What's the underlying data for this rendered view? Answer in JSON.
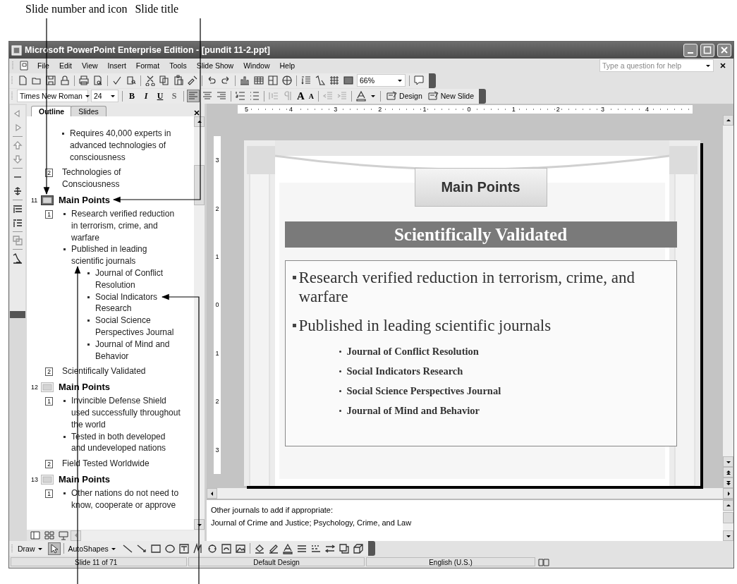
{
  "annotations": {
    "labels": [
      "Slide number and icon",
      "Slide title"
    ]
  },
  "window": {
    "title": "Microsoft PowerPoint Enterprise Edition - [pundit 11-2.ppt]"
  },
  "menu": [
    "File",
    "Edit",
    "View",
    "Insert",
    "Format",
    "Tools",
    "Slide Show",
    "Window",
    "Help"
  ],
  "help": {
    "placeholder": "Type a question for help"
  },
  "standard_toolbar": {
    "zoom": "66%"
  },
  "formatting_toolbar": {
    "font": "Times New Roman",
    "size": "24",
    "styles": [
      "B",
      "I",
      "U",
      "S"
    ],
    "font_size_buttons": [
      "A",
      "A"
    ],
    "buttons": [
      "Design",
      "New Slide"
    ]
  },
  "outline_pane": {
    "tabs": [
      {
        "label": "Outline",
        "selected": true
      },
      {
        "label": "Slides",
        "selected": false
      }
    ],
    "entries": [
      {
        "kind": "continuation",
        "placeholders": [
          {
            "bullets": [
              {
                "text": "Requires 40,000 experts in advanced technologies of consciousness"
              }
            ]
          },
          {
            "marker": "2",
            "text": "Technologies of Consciousness"
          }
        ]
      },
      {
        "kind": "slide",
        "number": "11",
        "title": "Main Points",
        "selected": true,
        "placeholders": [
          {
            "marker": "1",
            "bullets": [
              {
                "text": "Research verified reduction in terrorism, crime, and warfare"
              },
              {
                "text": "Published in leading scientific journals",
                "children": [
                  {
                    "text": "Journal of Conflict Resolution"
                  },
                  {
                    "text": "Social Indicators Research"
                  },
                  {
                    "text": "Social Science Perspectives Journal"
                  },
                  {
                    "text": "Journal of Mind and Behavior"
                  }
                ]
              }
            ]
          },
          {
            "marker": "2",
            "text": "Scientifically Validated"
          }
        ]
      },
      {
        "kind": "slide",
        "number": "12",
        "title": "Main Points",
        "selected": false,
        "placeholders": [
          {
            "marker": "1",
            "bullets": [
              {
                "text": "Invincible Defense Shield used successfully throughout the world"
              },
              {
                "text": "Tested in both developed and undeveloped nations"
              }
            ]
          },
          {
            "marker": "2",
            "text": "Field Tested Worldwide"
          }
        ]
      },
      {
        "kind": "slide",
        "number": "13",
        "title": "Main Points",
        "selected": false,
        "placeholders": [
          {
            "marker": "1",
            "bullets": [
              {
                "text": "Other nations do not need to know, cooperate or approve"
              }
            ]
          }
        ]
      }
    ]
  },
  "ruler": {
    "horizontal": [
      "5",
      "4",
      "3",
      "2",
      "1",
      "0",
      "1",
      "2",
      "3",
      "4"
    ],
    "vertical": [
      "3",
      "2",
      "1",
      "0",
      "1",
      "2",
      "3"
    ]
  },
  "slide": {
    "title": "Main Points",
    "banner": "Scientifically Validated",
    "bullets": [
      {
        "text": "Research verified reduction in terrorism, crime, and warfare"
      },
      {
        "text": "Published in leading scientific journals",
        "children": [
          {
            "text": "Journal of Conflict Resolution"
          },
          {
            "text": "Social Indicators Research"
          },
          {
            "text": "Social Science Perspectives Journal"
          },
          {
            "text": "Journal of Mind and Behavior"
          }
        ]
      }
    ]
  },
  "notes": [
    "Other journals to add if appropriate:",
    "Journal of Crime and Justice; Psychology, Crime, and Law"
  ],
  "drawing_toolbar": {
    "buttons": [
      "Draw",
      "AutoShapes"
    ]
  },
  "status_bar": [
    "Slide 11 of 71",
    "Default Design",
    "English (U.S.)"
  ]
}
